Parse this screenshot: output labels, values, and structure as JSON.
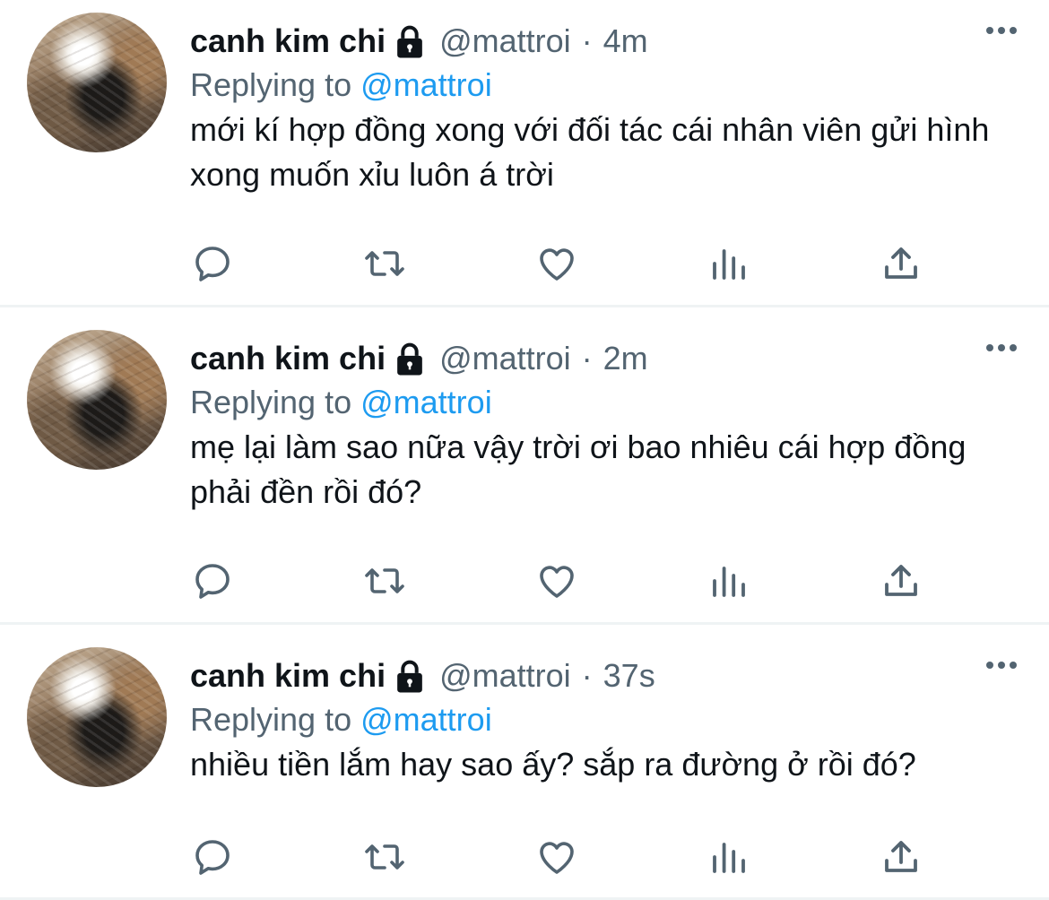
{
  "tweets": [
    {
      "name": "canh kim chi",
      "handle": "@mattroi",
      "separator": "·",
      "time": "4m",
      "replying_prefix": "Replying to",
      "replying_to": "@mattroi",
      "text": "mới kí hợp đồng xong với đối tác cái nhân viên gửi hình xong muốn xỉu luôn á trời"
    },
    {
      "name": "canh kim chi",
      "handle": "@mattroi",
      "separator": "·",
      "time": "2m",
      "replying_prefix": "Replying to",
      "replying_to": "@mattroi",
      "text": "mẹ lại làm sao nữa vậy trời ơi bao nhiêu cái hợp đồng phải đền rồi đó?"
    },
    {
      "name": "canh kim chi",
      "handle": "@mattroi",
      "separator": "·",
      "time": "37s",
      "replying_prefix": "Replying to",
      "replying_to": "@mattroi",
      "text": "nhiều tiền lắm hay sao ấy? sắp ra đường ở rồi đó?"
    }
  ],
  "icons": {
    "lock": "lock-icon",
    "more": "more-horizontal-icon",
    "reply": "reply-icon",
    "retweet": "retweet-icon",
    "like": "heart-icon",
    "views": "analytics-icon",
    "share": "share-icon"
  },
  "colors": {
    "text": "#0f1419",
    "secondary": "#536471",
    "link": "#1d9bf0",
    "divider": "#eff3f4"
  }
}
